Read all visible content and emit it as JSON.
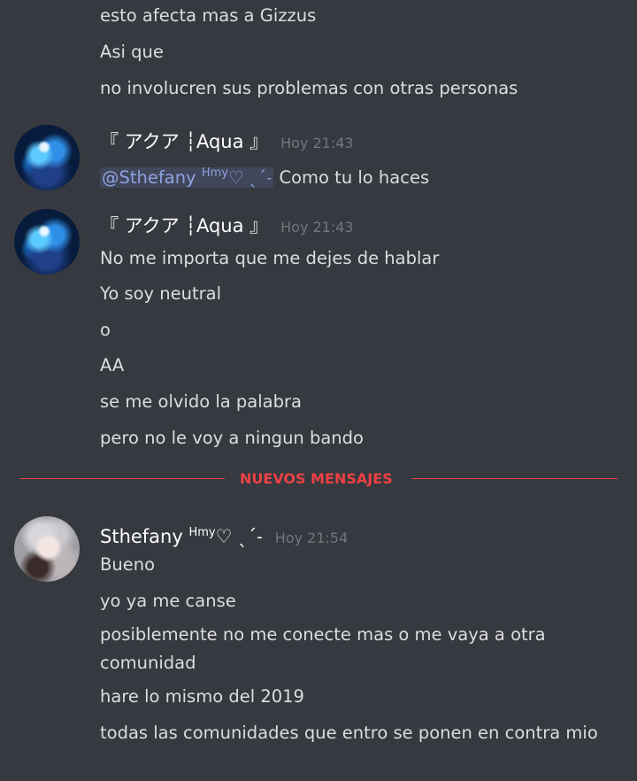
{
  "top_messages": [
    "esto afecta mas a Gizzus",
    "Asi que",
    "no involucren sus problemas con otras personas"
  ],
  "group1": {
    "author": "『 アクア ┆Aqua 』",
    "timestamp": "Hoy 21:43",
    "mention": "@Sthefany ",
    "mention_sup": "Hmy",
    "mention_tail": "♡ ˎˊ˗",
    "text": "Como tu lo haces"
  },
  "group2": {
    "author": "『 アクア ┆Aqua 』",
    "timestamp": "Hoy 21:43",
    "messages": [
      "No me importa que me dejes de hablar",
      "Yo soy neutral",
      "o",
      "AA",
      "se me olvido la palabra",
      "pero no le voy a ningun bando"
    ]
  },
  "divider_label": "NUEVOS MENSAJES",
  "group3": {
    "author": "Sthefany ",
    "author_sup": "Hmy",
    "author_tail": "♡ ˎˊ˗",
    "timestamp": "Hoy 21:54",
    "messages": [
      "Bueno",
      "yo ya me canse",
      "posiblemente no me conecte mas o me vaya a otra comunidad",
      "hare lo mismo del 2019",
      "todas las comunidades que entro se ponen en contra mio"
    ]
  },
  "colors": {
    "background": "#36393f",
    "text": "#dcddde",
    "username": "#ffffff",
    "timestamp": "#72767d",
    "mention": "#8ea1e1",
    "new_messages": "#ed4245"
  }
}
